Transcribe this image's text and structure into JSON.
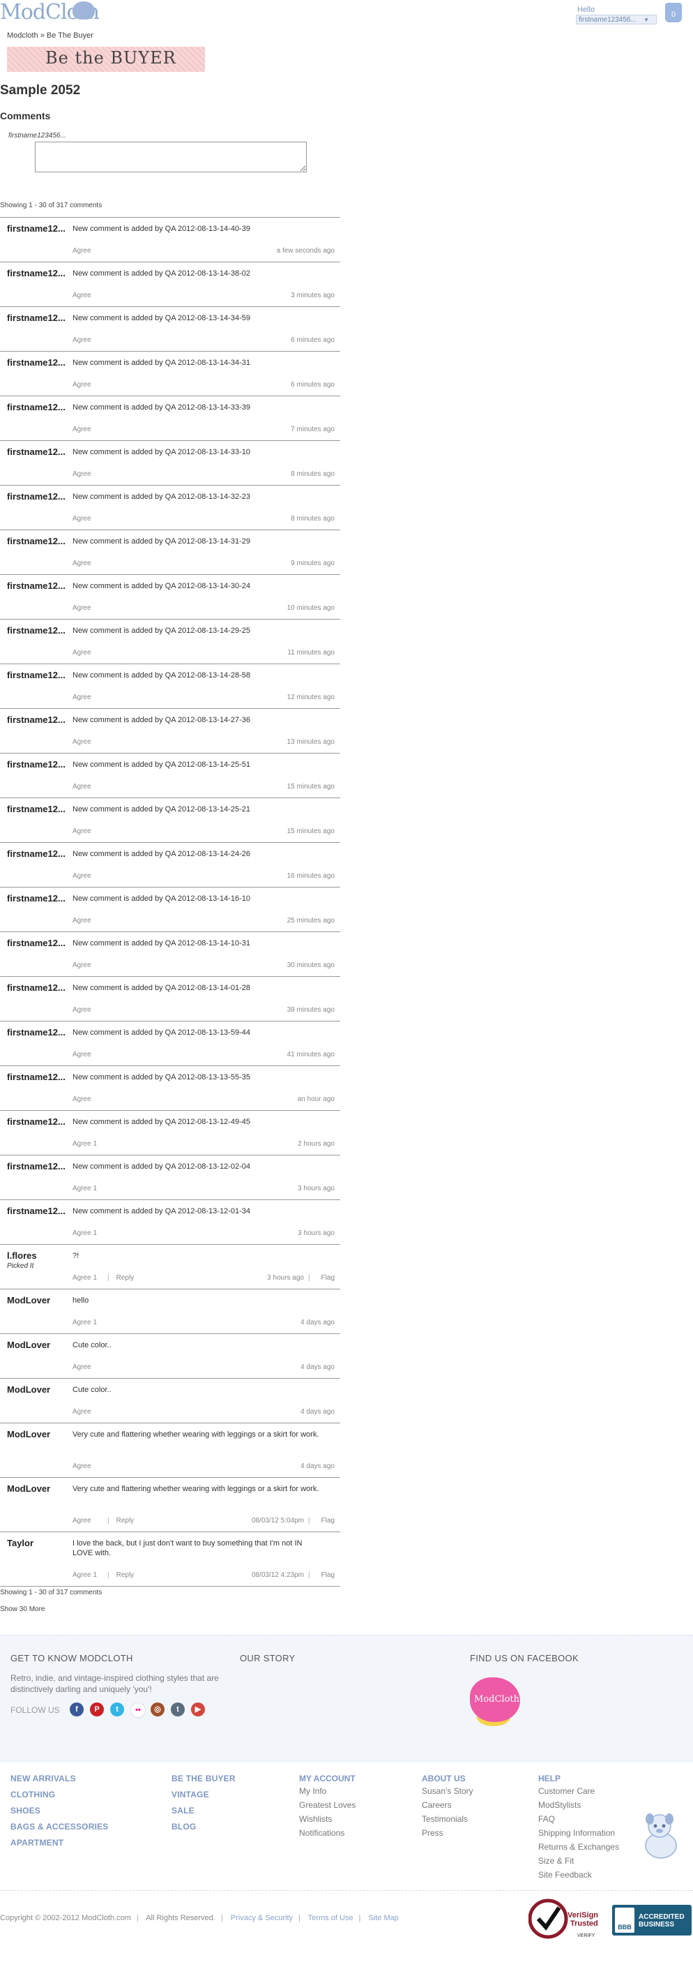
{
  "header": {
    "logo": "ModCloth",
    "greeting": "Hello",
    "user": "firstname123456...",
    "bag_count": "0",
    "breadcrumb": "Modcloth » Be The Buyer",
    "banner": "Be the BUYER"
  },
  "page": {
    "title": "Sample 2052",
    "comments_heading": "Comments",
    "compose_user": "firstname123456...",
    "showing_top": "Showing 1 - 30 of 317 comments",
    "showing_bottom": "Showing 1 - 30 of 317 comments",
    "show_more": "Show 30 More"
  },
  "comments": [
    {
      "name": "firstname12...",
      "text": "New comment is added by QA 2012-08-13-14-40-39",
      "agree": "Agree",
      "time": "a few seconds ago"
    },
    {
      "name": "firstname12...",
      "text": "New comment is added by QA 2012-08-13-14-38-02",
      "agree": "Agree",
      "time": "3 minutes ago"
    },
    {
      "name": "firstname12...",
      "text": "New comment is added by QA 2012-08-13-14-34-59",
      "agree": "Agree",
      "time": "6 minutes ago"
    },
    {
      "name": "firstname12...",
      "text": "New comment is added by QA 2012-08-13-14-34-31",
      "agree": "Agree",
      "time": "6 minutes ago"
    },
    {
      "name": "firstname12...",
      "text": "New comment is added by QA 2012-08-13-14-33-39",
      "agree": "Agree",
      "time": "7 minutes ago"
    },
    {
      "name": "firstname12...",
      "text": "New comment is added by QA 2012-08-13-14-33-10",
      "agree": "Agree",
      "time": "8 minutes ago"
    },
    {
      "name": "firstname12...",
      "text": "New comment is added by QA 2012-08-13-14-32-23",
      "agree": "Agree",
      "time": "8 minutes ago"
    },
    {
      "name": "firstname12...",
      "text": "New comment is added by QA 2012-08-13-14-31-29",
      "agree": "Agree",
      "time": "9 minutes ago"
    },
    {
      "name": "firstname12...",
      "text": "New comment is added by QA 2012-08-13-14-30-24",
      "agree": "Agree",
      "time": "10 minutes ago"
    },
    {
      "name": "firstname12...",
      "text": "New comment is added by QA 2012-08-13-14-29-25",
      "agree": "Agree",
      "time": "11 minutes ago"
    },
    {
      "name": "firstname12...",
      "text": "New comment is added by QA 2012-08-13-14-28-58",
      "agree": "Agree",
      "time": "12 minutes ago"
    },
    {
      "name": "firstname12...",
      "text": "New comment is added by QA 2012-08-13-14-27-36",
      "agree": "Agree",
      "time": "13 minutes ago"
    },
    {
      "name": "firstname12...",
      "text": "New comment is added by QA 2012-08-13-14-25-51",
      "agree": "Agree",
      "time": "15 minutes ago"
    },
    {
      "name": "firstname12...",
      "text": "New comment is added by QA 2012-08-13-14-25-21",
      "agree": "Agree",
      "time": "15 minutes ago"
    },
    {
      "name": "firstname12...",
      "text": "New comment is added by QA 2012-08-13-14-24-26",
      "agree": "Agree",
      "time": "16 minutes ago"
    },
    {
      "name": "firstname12...",
      "text": "New comment is added by QA 2012-08-13-14-16-10",
      "agree": "Agree",
      "time": "25 minutes ago"
    },
    {
      "name": "firstname12...",
      "text": "New comment is added by QA 2012-08-13-14-10-31",
      "agree": "Agree",
      "time": "30 minutes ago"
    },
    {
      "name": "firstname12...",
      "text": "New comment is added by QA 2012-08-13-14-01-28",
      "agree": "Agree",
      "time": "39 minutes ago"
    },
    {
      "name": "firstname12...",
      "text": "New comment is added by QA 2012-08-13-13-59-44",
      "agree": "Agree",
      "time": "41 minutes ago"
    },
    {
      "name": "firstname12...",
      "text": "New comment is added by QA 2012-08-13-13-55-35",
      "agree": "Agree",
      "time": "an hour ago"
    },
    {
      "name": "firstname12...",
      "text": "New comment is added by QA 2012-08-13-12-49-45",
      "agree": "Agree 1",
      "time": "2 hours ago"
    },
    {
      "name": "firstname12...",
      "text": "New comment is added by QA 2012-08-13-12-02-04",
      "agree": "Agree 1",
      "time": "3 hours ago"
    },
    {
      "name": "firstname12...",
      "text": "New comment is added by QA 2012-08-13-12-01-34",
      "agree": "Agree 1",
      "time": "3 hours ago"
    },
    {
      "name": "l.flores",
      "badge": "Picked It",
      "text": "?!",
      "agree": "Agree 1",
      "reply": "Reply",
      "time": "3 hours ago",
      "flag": "Flag"
    },
    {
      "name": "ModLover",
      "text": "hello",
      "agree": "Agree 1",
      "time": "4 days ago"
    },
    {
      "name": "ModLover",
      "text": "Cute color..",
      "agree": "Agree",
      "time": "4 days ago"
    },
    {
      "name": "ModLover",
      "text": "Cute color..",
      "agree": "Agree",
      "time": "4 days ago"
    },
    {
      "name": "ModLover",
      "text": "Very cute and flattering whether wearing with leggings or a skirt for work.",
      "agree": "Agree",
      "time": "4 days ago"
    },
    {
      "name": "ModLover",
      "text": "Very cute and flattering whether wearing with leggings or a skirt for work.",
      "agree": "Agree",
      "reply": "Reply",
      "time": "08/03/12 5:04pm",
      "flag": "Flag"
    },
    {
      "name": "Taylor",
      "text": "I love the back, but I just don't want to buy something that I'm not IN LOVE with.",
      "agree": "Agree 1",
      "reply": "Reply",
      "time": "08/03/12 4:23pm",
      "flag": "Flag"
    }
  ],
  "footer": {
    "get_to_know": "GET TO KNOW MODCLOTH",
    "description": "Retro, indie, and vintage-inspired clothing styles that are distinctively darling and uniquely 'you'!",
    "follow_us": "FOLLOW US",
    "our_story": "OUR STORY",
    "find_us": "FIND US ON FACEBOOK",
    "fb_logo": "ModCloth",
    "shop_links_1": [
      "NEW ARRIVALS",
      "CLOTHING",
      "SHOES",
      "BAGS & ACCESSORIES",
      "APARTMENT"
    ],
    "shop_links_2": [
      "BE THE BUYER",
      "VINTAGE",
      "SALE",
      "BLOG"
    ],
    "my_account": {
      "title": "MY ACCOUNT",
      "links": [
        "My Info",
        "Greatest Loves",
        "Wishlists",
        "Notifications"
      ]
    },
    "about_us": {
      "title": "ABOUT US",
      "links": [
        "Susan's Story",
        "Careers",
        "Testimonials",
        "Press"
      ]
    },
    "help": {
      "title": "HELP",
      "links": [
        "Customer Care",
        "ModStylists",
        "FAQ",
        "Shipping Information",
        "Returns & Exchanges",
        "Size & Fit",
        "Site Feedback"
      ]
    },
    "copyright": "Copyright © 2002-2012 ModCloth.com",
    "rights": "All Rights Reserved.",
    "privacy": "Privacy & Security",
    "terms": "Terms of Use",
    "sitemap": "Site Map",
    "verisign_1": "VeriSign",
    "verisign_2": "Trusted",
    "verisign_3": "VERIFY",
    "bbb_logo": "BBB",
    "bbb_1": "ACCREDITED",
    "bbb_2": "BUSINESS"
  },
  "colors": {
    "link_blue": "#7e97c4",
    "footer_bg": "#f2f6fb",
    "banner_pink": "#f4c9c9",
    "social": [
      "#3b5998",
      "#cb2027",
      "#33b5e5",
      "#ff0084",
      "#a0522d",
      "#5a6e7f",
      "#d3463d"
    ]
  },
  "icons": {
    "social": [
      "facebook-icon",
      "pinterest-icon",
      "twitter-icon",
      "flickr-icon",
      "instagram-icon",
      "tumblr-icon",
      "youtube-icon"
    ]
  }
}
